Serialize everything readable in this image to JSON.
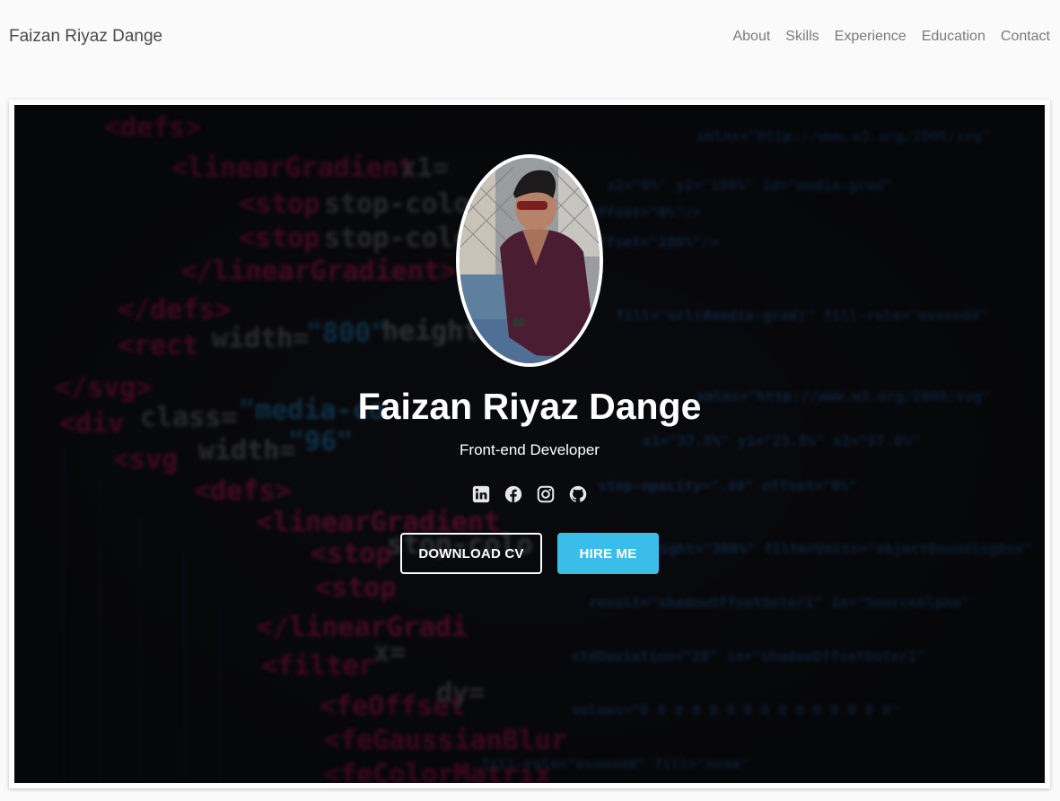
{
  "navbar": {
    "brand": "Faizan Riyaz Dange",
    "links": [
      "About",
      "Skills",
      "Experience",
      "Education",
      "Contact"
    ]
  },
  "hero": {
    "name": "Faizan Riyaz Dange",
    "role": "Front-end Developer",
    "social_icons": [
      "linkedin-icon",
      "facebook-icon",
      "instagram-icon",
      "github-icon"
    ],
    "buttons": {
      "download_cv": "DOWNLOAD CV",
      "hire_me": "HIRE ME"
    }
  },
  "colors": {
    "accent": "#3bbdea",
    "hero_bg": "#0b0c10",
    "nav_text": "#7a7a7a"
  }
}
